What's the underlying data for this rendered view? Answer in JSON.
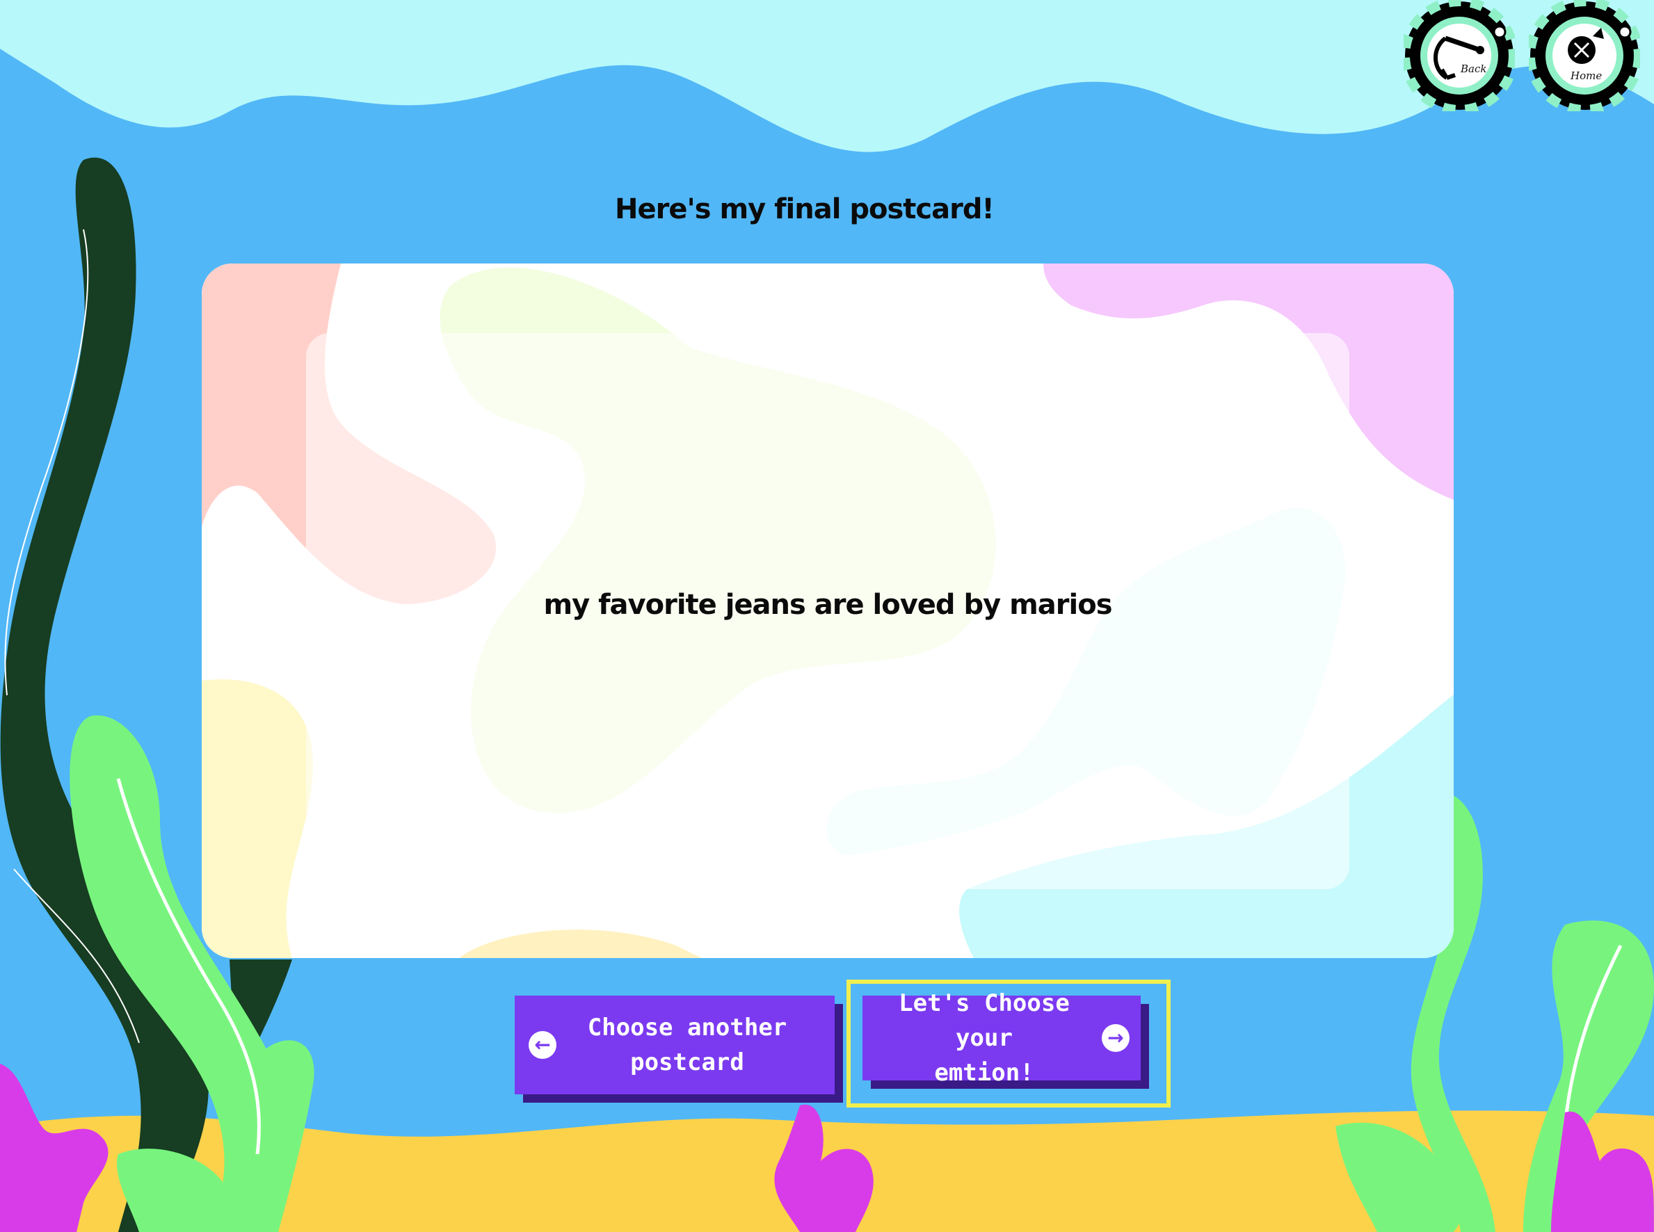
{
  "nav": {
    "back": {
      "label": "Back",
      "icon": "anchor-icon"
    },
    "home": {
      "label": "Home",
      "icon": "compass-icon"
    }
  },
  "page": {
    "title": "Here's my final postcard!"
  },
  "postcard": {
    "message": "my favorite jeans are loved by marios"
  },
  "buttons": {
    "choose_another": "Choose another\npostcard",
    "choose_emotion": "Let's Choose your\nemtion!"
  },
  "colors": {
    "water": "#52b7f6",
    "surface": "#b7f8fb",
    "sand": "#fcd24a",
    "button": "#7b3af0",
    "button_shadow": "#3a1a86",
    "focus_outline": "#f1ef4f",
    "seaweed_dark": "#173d22",
    "seaweed_light": "#78f47e",
    "coral": "#d83ce8"
  }
}
